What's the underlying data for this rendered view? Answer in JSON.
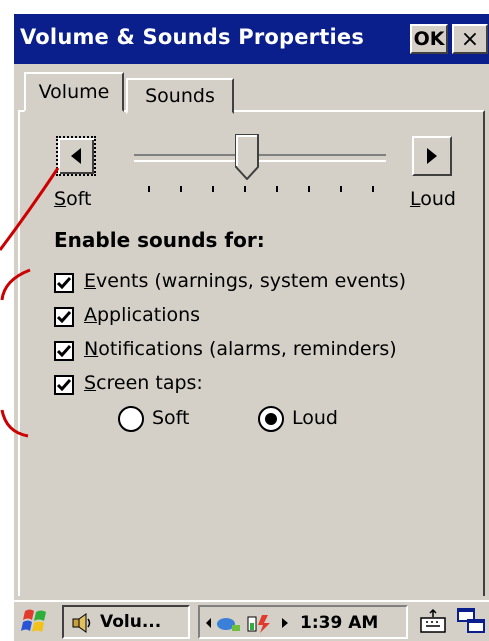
{
  "window": {
    "title": "Volume & Sounds Properties",
    "ok_label": "OK",
    "close_label": "×"
  },
  "tabs": [
    {
      "label": "Volume",
      "selected": true
    },
    {
      "label": "Sounds",
      "selected": false
    }
  ],
  "volume": {
    "soft_label_key": "S",
    "soft_label_rest": "oft",
    "loud_label_key": "L",
    "loud_label_rest": "oud",
    "level": 0.45,
    "tick_count": 8
  },
  "enable_sounds": {
    "heading": "Enable sounds for:",
    "items": [
      {
        "key": "E",
        "rest": "vents (warnings, system events)",
        "checked": true
      },
      {
        "key": "A",
        "rest": "pplications",
        "checked": true
      },
      {
        "key": "N",
        "rest": "otifications (alarms, reminders)",
        "checked": true
      },
      {
        "key": "S",
        "rest": "creen taps:",
        "checked": true
      }
    ],
    "screen_tap_options": [
      {
        "label": "Soft",
        "selected": false
      },
      {
        "label": "Loud",
        "selected": true
      }
    ]
  },
  "taskbar": {
    "task_label": "Volu...",
    "clock": "1:39 AM"
  },
  "colors": {
    "titlebar": "#0a1e8c",
    "face": "#d4d0c8",
    "annotation": "#cc0000"
  }
}
